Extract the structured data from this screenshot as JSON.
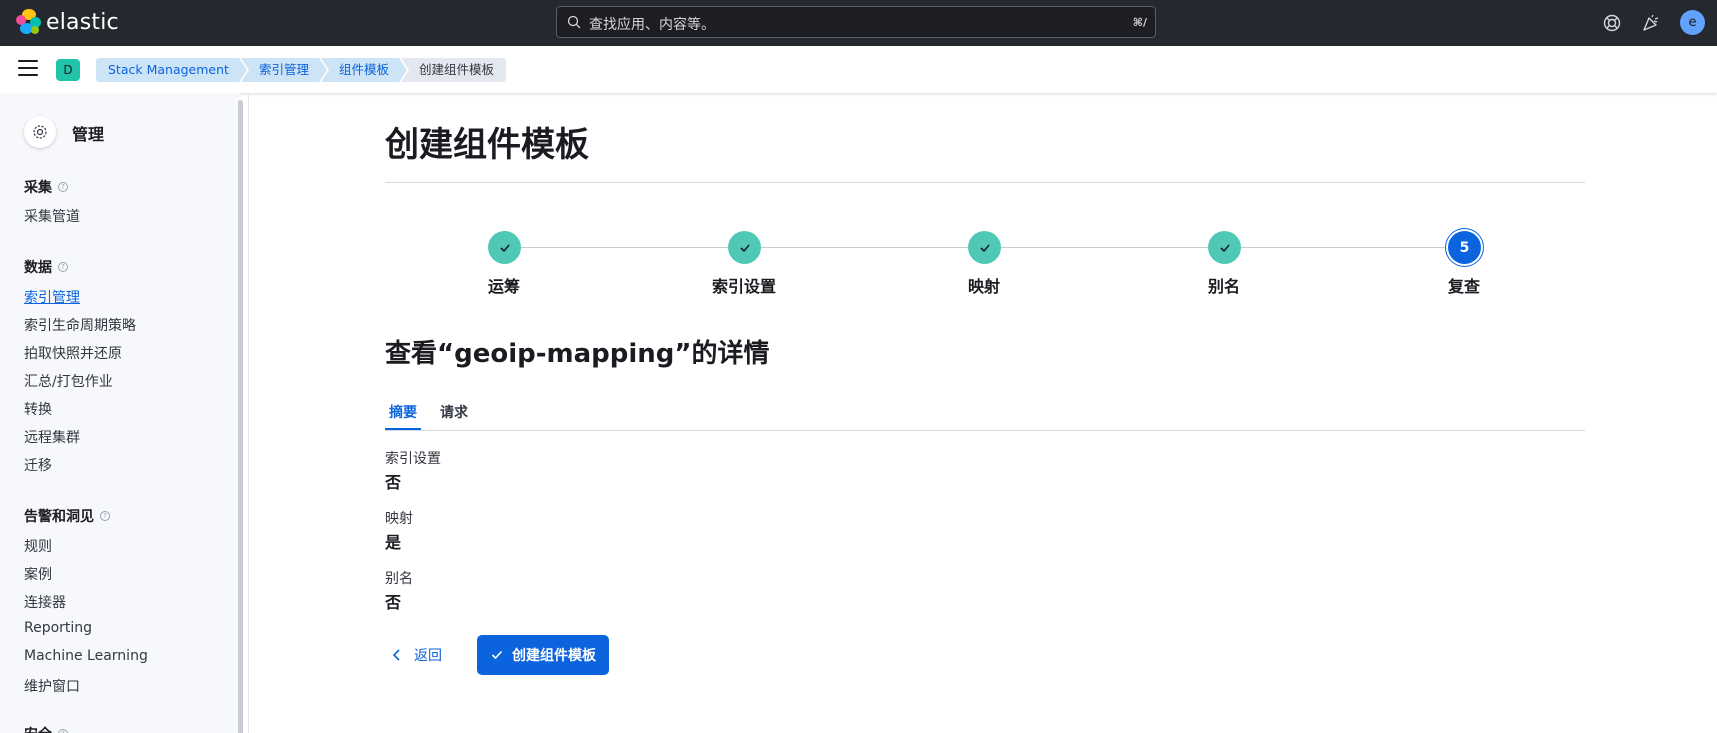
{
  "header": {
    "logo_text": "elastic",
    "search_placeholder": "查找应用、内容等。",
    "search_shortcut": "⌘/",
    "avatar_initial": "e"
  },
  "space": {
    "initial": "D"
  },
  "breadcrumbs": [
    "Stack Management",
    "索引管理",
    "组件模板",
    "创建组件模板"
  ],
  "sidebar": {
    "title": "管理",
    "groups": [
      {
        "label": "采集",
        "items": [
          "采集管道"
        ]
      },
      {
        "label": "数据",
        "items": [
          "索引管理",
          "索引生命周期策略",
          "拍取快照并还原",
          "汇总/打包作业",
          "转换",
          "远程集群",
          "迁移"
        ]
      },
      {
        "label": "告警和洞见",
        "items": [
          "规则",
          "案例",
          "连接器",
          "Reporting",
          "Machine Learning",
          "维护窗口"
        ]
      },
      {
        "label": "安全",
        "items": []
      }
    ],
    "active_item": "索引管理"
  },
  "main": {
    "page_title": "创建组件模板",
    "steps": [
      {
        "label": "运筹",
        "state": "done"
      },
      {
        "label": "索引设置",
        "state": "done"
      },
      {
        "label": "映射",
        "state": "done"
      },
      {
        "label": "别名",
        "state": "done"
      },
      {
        "label": "复查",
        "state": "current",
        "number": "5"
      }
    ],
    "detail_title": "查看“geoip-mapping”的详情",
    "tabs": [
      {
        "label": "摘要",
        "active": true
      },
      {
        "label": "请求",
        "active": false
      }
    ],
    "summary": [
      {
        "term": "索引设置",
        "value": "否"
      },
      {
        "term": "映射",
        "value": "是"
      },
      {
        "term": "别名",
        "value": "否"
      }
    ],
    "back_label": "返回",
    "create_label": "创建组件模板"
  },
  "colors": {
    "accent": "#0b64dd",
    "step_done": "#4fc9b5",
    "header_bg": "#25282f",
    "space_badge": "#20c4a8"
  }
}
